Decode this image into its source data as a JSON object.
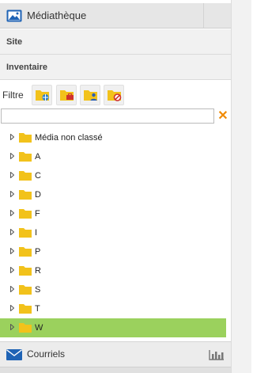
{
  "header": {
    "title": "Médiathèque",
    "icon": "image-icon"
  },
  "sections": [
    {
      "label": "Site"
    },
    {
      "label": "Inventaire"
    }
  ],
  "filter": {
    "label": "Filtre",
    "buttons": [
      {
        "icon": "folder-globe-icon"
      },
      {
        "icon": "folder-briefcase-icon"
      },
      {
        "icon": "folder-user-icon"
      },
      {
        "icon": "folder-forbidden-icon"
      }
    ]
  },
  "search": {
    "value": "",
    "placeholder": ""
  },
  "tree": {
    "items": [
      {
        "label": "Média non classé"
      },
      {
        "label": "A"
      },
      {
        "label": "C"
      },
      {
        "label": "D"
      },
      {
        "label": "F"
      },
      {
        "label": "I"
      },
      {
        "label": "P"
      },
      {
        "label": "R"
      },
      {
        "label": "S"
      },
      {
        "label": "T"
      },
      {
        "label": "W",
        "selected": true
      }
    ]
  },
  "footer": {
    "title": "Courriels",
    "icon": "mail-icon",
    "stats_icon": "bar-chart-icon"
  },
  "colors": {
    "selected_row": "#9bd15d",
    "folder": "#f2c21b",
    "clear_icon": "#f08a00",
    "mail_icon": "#1f63b5"
  }
}
